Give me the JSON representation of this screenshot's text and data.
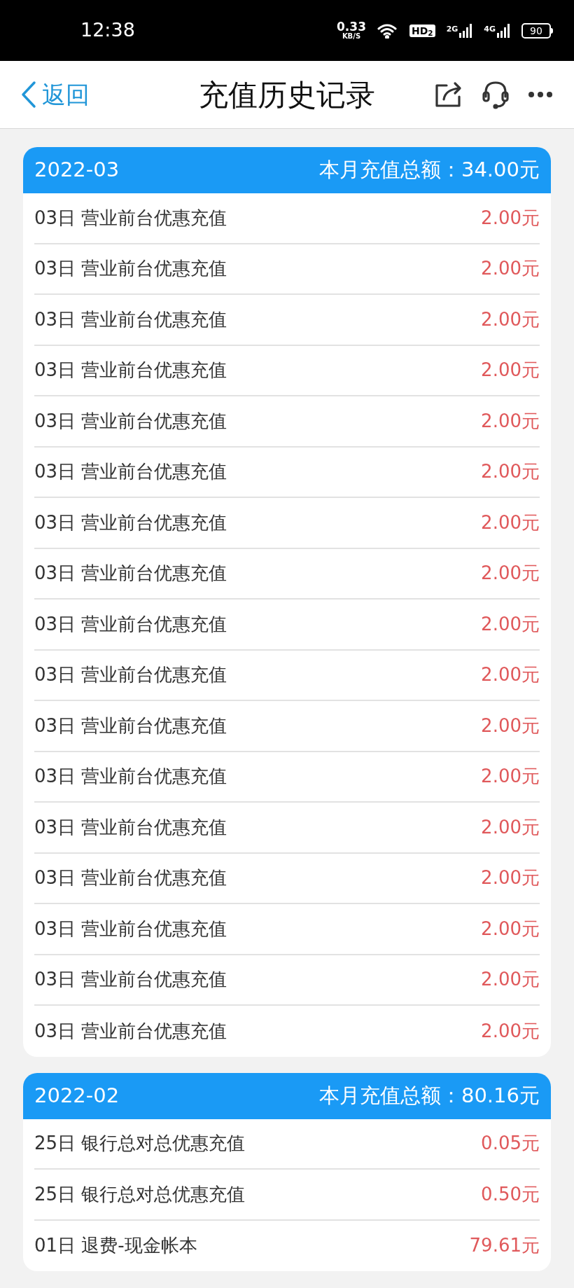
{
  "status_bar": {
    "time": "12:38",
    "net_speed": "0.33",
    "net_unit": "KB/S",
    "hd": "HD$_{2}$",
    "sim1": "2G",
    "sim2": "4G",
    "battery": "90"
  },
  "header": {
    "back": "返回",
    "title": "充值历史记录"
  },
  "months": [
    {
      "month": "2022-03",
      "total": "本月充值总额：34.00元",
      "rows": [
        {
          "label": "03日 营业前台优惠充值",
          "amount": "2.00元"
        },
        {
          "label": "03日 营业前台优惠充值",
          "amount": "2.00元"
        },
        {
          "label": "03日 营业前台优惠充值",
          "amount": "2.00元"
        },
        {
          "label": "03日 营业前台优惠充值",
          "amount": "2.00元"
        },
        {
          "label": "03日 营业前台优惠充值",
          "amount": "2.00元"
        },
        {
          "label": "03日 营业前台优惠充值",
          "amount": "2.00元"
        },
        {
          "label": "03日 营业前台优惠充值",
          "amount": "2.00元"
        },
        {
          "label": "03日 营业前台优惠充值",
          "amount": "2.00元"
        },
        {
          "label": "03日 营业前台优惠充值",
          "amount": "2.00元"
        },
        {
          "label": "03日 营业前台优惠充值",
          "amount": "2.00元"
        },
        {
          "label": "03日 营业前台优惠充值",
          "amount": "2.00元"
        },
        {
          "label": "03日 营业前台优惠充值",
          "amount": "2.00元"
        },
        {
          "label": "03日 营业前台优惠充值",
          "amount": "2.00元"
        },
        {
          "label": "03日 营业前台优惠充值",
          "amount": "2.00元"
        },
        {
          "label": "03日 营业前台优惠充值",
          "amount": "2.00元"
        },
        {
          "label": "03日 营业前台优惠充值",
          "amount": "2.00元"
        },
        {
          "label": "03日 营业前台优惠充值",
          "amount": "2.00元"
        }
      ]
    },
    {
      "month": "2022-02",
      "total": "本月充值总额：80.16元",
      "rows": [
        {
          "label": "25日 银行总对总优惠充值",
          "amount": "0.05元"
        },
        {
          "label": "25日 银行总对总优惠充值",
          "amount": "0.50元"
        },
        {
          "label": "01日 退费-现金帐本",
          "amount": "79.61元"
        }
      ]
    }
  ]
}
